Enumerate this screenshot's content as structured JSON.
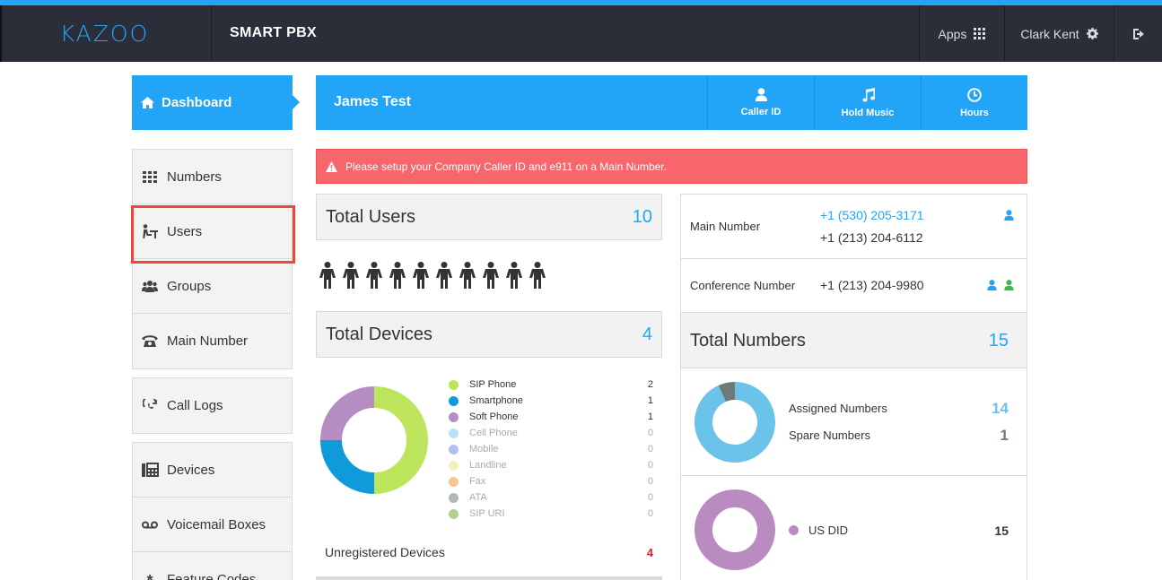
{
  "topbar": {
    "logo": "KAZOO",
    "app_title": "SMART PBX",
    "apps_label": "Apps",
    "user_name": "Clark Kent"
  },
  "sidebar": {
    "dashboard": "Dashboard",
    "items": [
      {
        "label": "Numbers",
        "icon": "grid-icon"
      },
      {
        "label": "Users",
        "icon": "user-desk-icon"
      },
      {
        "label": "Groups",
        "icon": "users-group-icon"
      },
      {
        "label": "Main Number",
        "icon": "phone-icon"
      },
      {
        "label": "Call Logs",
        "icon": "call-logs-icon"
      },
      {
        "label": "Devices",
        "icon": "fax-device-icon"
      },
      {
        "label": "Voicemail Boxes",
        "icon": "voicemail-icon"
      },
      {
        "label": "Feature Codes",
        "icon": "asterisk-icon"
      }
    ]
  },
  "header": {
    "account_name": "James Test",
    "buttons": [
      {
        "label": "Caller ID",
        "icon": "user-icon"
      },
      {
        "label": "Hold Music",
        "icon": "music-icon"
      },
      {
        "label": "Hours",
        "icon": "clock-icon"
      }
    ]
  },
  "alert": {
    "text": "Please setup your Company Caller ID and e911 on a Main Number."
  },
  "users_card": {
    "title": "Total Users",
    "count": "10"
  },
  "devices_card": {
    "title": "Total Devices",
    "count": "4",
    "legend": [
      {
        "label": "SIP Phone",
        "value": "2",
        "color": "#bde55c"
      },
      {
        "label": "Smartphone",
        "value": "1",
        "color": "#0f9ad9"
      },
      {
        "label": "Soft Phone",
        "value": "1",
        "color": "#b58dc3"
      },
      {
        "label": "Cell Phone",
        "value": "0",
        "color": "#b9e2f7"
      },
      {
        "label": "Mobile",
        "value": "0",
        "color": "#b3c0ee"
      },
      {
        "label": "Landline",
        "value": "0",
        "color": "#f3efb8"
      },
      {
        "label": "Fax",
        "value": "0",
        "color": "#f8c692"
      },
      {
        "label": "ATA",
        "value": "0",
        "color": "#b0b8b5"
      },
      {
        "label": "SIP URI",
        "value": "0",
        "color": "#aed090"
      }
    ],
    "unregistered_label": "Unregistered Devices",
    "unregistered_value": "4"
  },
  "numbers_panel": {
    "main_number_label": "Main Number",
    "main_number_1": "+1 (530) 205-3171",
    "main_number_2": "+1 (213) 204-6112",
    "conference_label": "Conference Number",
    "conference_number": "+1 (213) 204-9980",
    "total_title": "Total Numbers",
    "total_value": "15",
    "assigned_label": "Assigned Numbers",
    "assigned_value": "14",
    "spare_label": "Spare Numbers",
    "spare_value": "1",
    "us_did_label": "US DID",
    "us_did_value": "15",
    "colors": {
      "assigned": "#6cc3ea",
      "spare": "#6d7a7a",
      "us_did": "#b98bc0",
      "green": "#3dbb47",
      "blue": "#22a5f7"
    }
  }
}
